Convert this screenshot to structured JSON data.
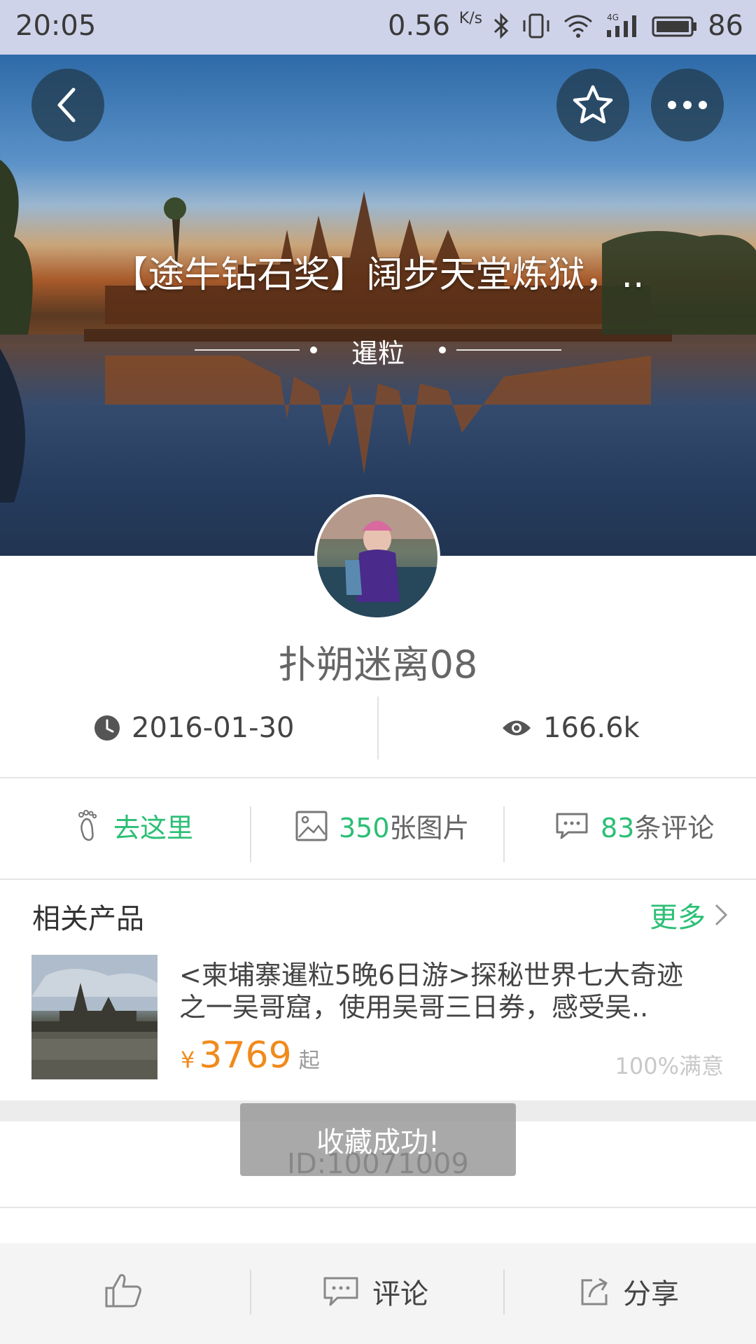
{
  "status_bar": {
    "time": "20:05",
    "net_speed": "0.56",
    "net_unit": "K/s",
    "battery": "86",
    "icons": [
      "bluetooth-icon",
      "vibrate-icon",
      "wifi-icon",
      "signal-4g-icon",
      "battery-icon"
    ]
  },
  "hero": {
    "title": "【途牛钻石奖】阔步天堂炼狱，..",
    "location": "暹粒",
    "icons": [
      "back-icon",
      "star-icon",
      "more-icon"
    ]
  },
  "author": {
    "name": "扑朔迷离08"
  },
  "meta": {
    "date": "2016-01-30",
    "views": "166.6k"
  },
  "actions": {
    "go_here": "去这里",
    "photos_count": "350",
    "photos_suffix": "张图片",
    "comments_count": "83",
    "comments_suffix": "条评论"
  },
  "related": {
    "title": "相关产品",
    "more": "更多",
    "product": {
      "title_line1": "<柬埔寨暹粒5晚6日游>探秘世界七大奇迹",
      "title_line2": "之一吴哥窟，使用吴哥三日券，感受吴..",
      "currency": "¥",
      "price": "3769",
      "price_suffix": "起",
      "satisfaction": "100%满意"
    }
  },
  "toast": {
    "message": "收藏成功!"
  },
  "article_id": "ID:10071009",
  "bottom_bar": {
    "comment": "评论",
    "share": "分享"
  },
  "colors": {
    "accent_green": "#2bbf75",
    "price_orange": "#f08a1c"
  }
}
